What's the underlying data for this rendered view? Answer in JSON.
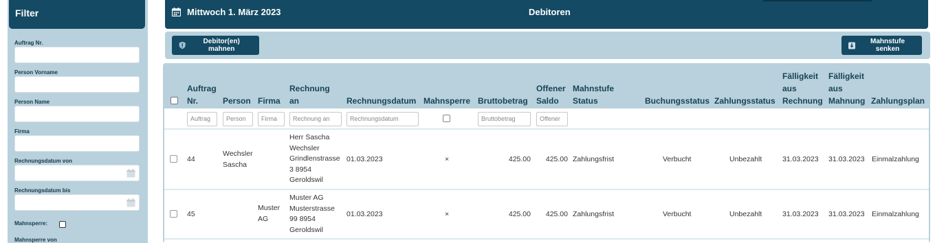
{
  "sidebar": {
    "title": "Filter",
    "fields": [
      {
        "label": "Auftrag Nr.",
        "value": ""
      },
      {
        "label": "Person Vorname",
        "value": ""
      },
      {
        "label": "Person Name",
        "value": ""
      },
      {
        "label": "Firma",
        "value": ""
      },
      {
        "label": "Rechnungsdatum von",
        "value": ""
      },
      {
        "label": "Rechnungsdatum bis",
        "value": ""
      }
    ],
    "mahnsperre_label": "Mahnsperre:",
    "mahnsperre_von_label": "Mahnsperre von"
  },
  "header": {
    "date": "Mittwoch 1. März 2023",
    "title": "Debitoren"
  },
  "toolbar": {
    "mahnen_label": "Debitor(en) mahnen",
    "senken_label": "Mahnstufe senken"
  },
  "table": {
    "columns": {
      "auftrag": "Auftrag\nNr.",
      "person": "Person",
      "firma": "Firma",
      "rechnung_an": "Rechnung\nan",
      "rechnungsdatum": "Rechnungsdatum",
      "mahnsperre": "Mahnsperre",
      "bruttobetrag": "Bruttobetrag",
      "offener_saldo": "Offener\nSaldo",
      "mahnstufe": "Mahnstufe\nStatus",
      "buchungsstatus": "Buchungsstatus",
      "zahlungsstatus": "Zahlungsstatus",
      "faellig_rechnung": "Fälligkeit\naus\nRechnung",
      "faellig_mahnung": "Fälligkeit\naus\nMahnung",
      "zahlungsplan": "Zahlungsplan"
    },
    "search_placeholders": {
      "auftrag": "Auftrag",
      "person": "Person",
      "firma": "Firma",
      "rechnung_an": "Rechnung an",
      "rechnungsdatum": "Rechnungsdatum",
      "bruttobetrag": "Bruttobetrag",
      "offener_saldo": "Offener"
    },
    "rows": [
      {
        "auftrag": "44",
        "person": "Wechsler\nSascha",
        "firma": "",
        "rechnung_an": "Herr Sascha\nWechsler\nGrindlenstrasse\n3 8954\nGeroldswil",
        "rechnungsdatum": "01.03.2023",
        "mahnsperre": "×",
        "bruttobetrag": "425.00",
        "offener_saldo": "425.00",
        "mahnstufe": "Zahlungsfrist",
        "buchungsstatus": "Verbucht",
        "zahlungsstatus": "Unbezahlt",
        "faellig_rechnung": "31.03.2023",
        "faellig_mahnung": "31.03.2023",
        "zahlungsplan": "Einmalzahlung"
      },
      {
        "auftrag": "45",
        "person": "",
        "firma": "Muster\nAG",
        "rechnung_an": "Muster AG\nMusterstrasse\n99 8954\nGeroldswil",
        "rechnungsdatum": "01.03.2023",
        "mahnsperre": "×",
        "bruttobetrag": "425.00",
        "offener_saldo": "425.00",
        "mahnstufe": "Zahlungsfrist",
        "buchungsstatus": "Verbucht",
        "zahlungsstatus": "Unbezahlt",
        "faellig_rechnung": "31.03.2023",
        "faellig_mahnung": "31.03.2023",
        "zahlungsplan": "Einmalzahlung"
      }
    ]
  },
  "icons": {
    "calendar": "calendar-icon",
    "shield": "shield-icon",
    "download": "download-arrow-icon"
  },
  "colors": {
    "primary": "#144a63",
    "panel": "#b9d1dc",
    "heading_text": "#174458"
  }
}
